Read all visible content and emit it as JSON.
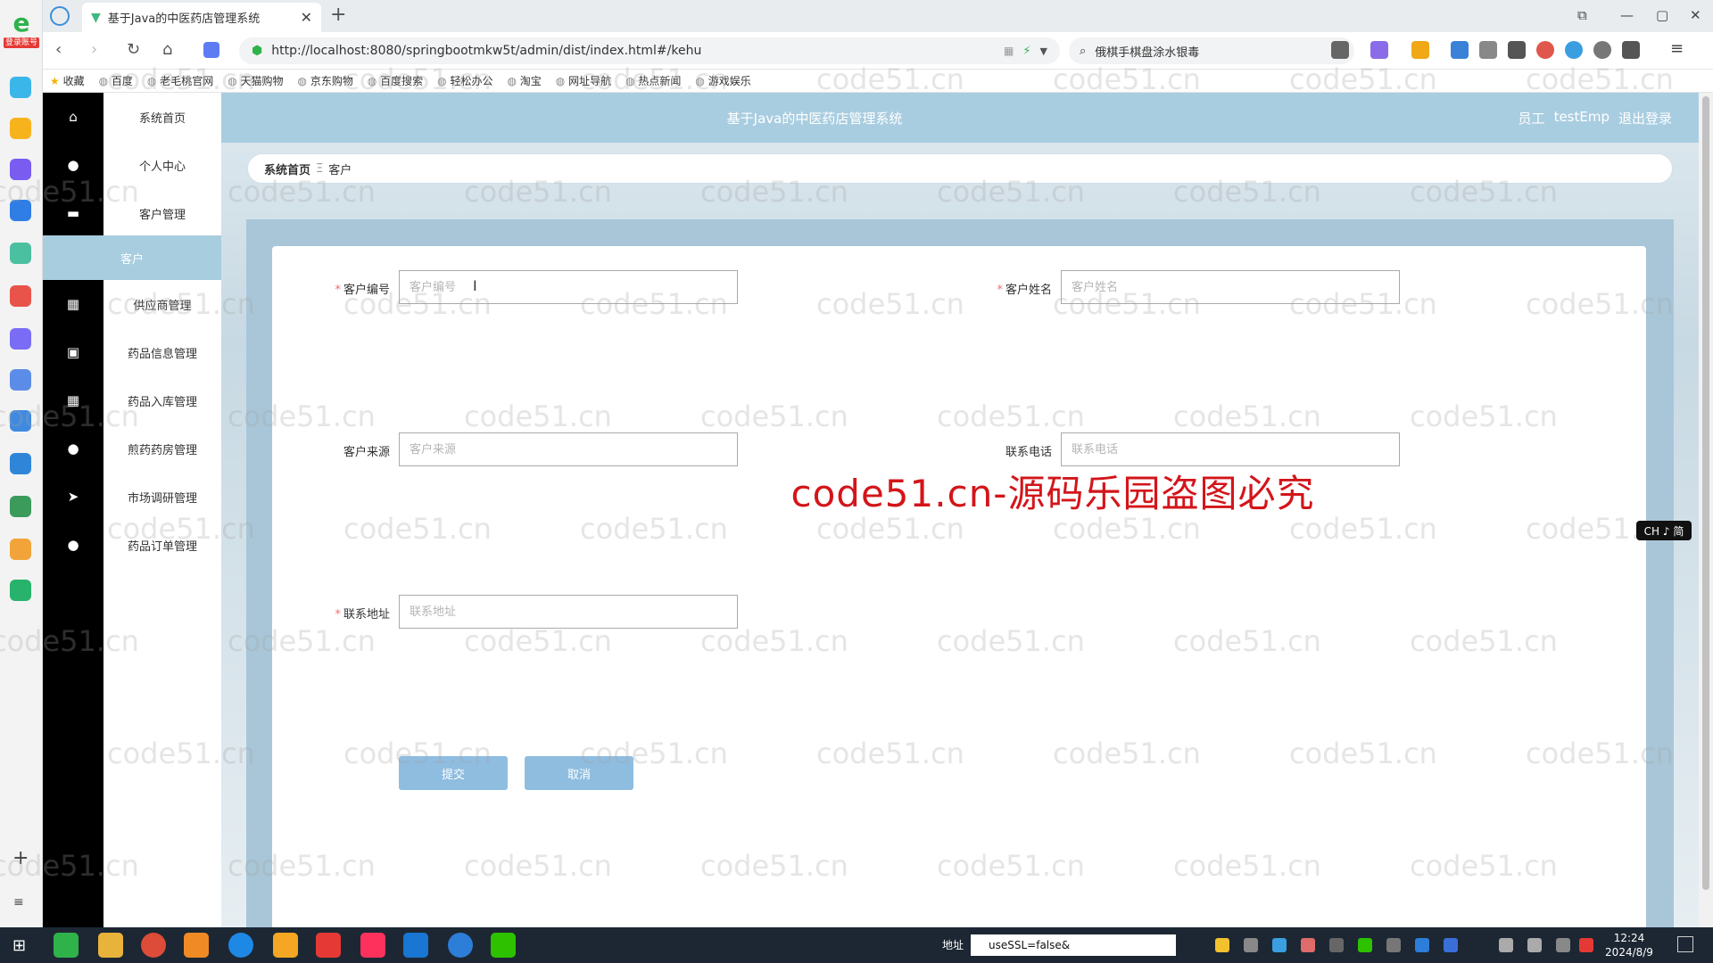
{
  "browser": {
    "tab_title": "基于Java的中医药店管理系统",
    "url": "http://localhost:8080/springbootmkw5t/admin/dist/index.html#/kehu",
    "search_text": "俄棋手棋盘涂水银毒",
    "new_tab": "+",
    "bookmarks": [
      "收藏",
      "百度",
      "老毛桃官网",
      "天猫购物",
      "京东购物",
      "百度搜索",
      "轻松办公",
      "淘宝",
      "网址导航",
      "热点新闻",
      "游戏娱乐"
    ]
  },
  "rail": {
    "badge": "登录账号"
  },
  "app": {
    "title": "基于Java的中医药店管理系统",
    "user_role": "员工",
    "username": "testEmp",
    "logout": "退出登录"
  },
  "menu": {
    "items": [
      "系统首页",
      "个人中心",
      "客户管理",
      "供应商管理",
      "药品信息管理",
      "药品入库管理",
      "煎药药房管理",
      "市场调研管理",
      "药品订单管理"
    ],
    "active_sub": "客户"
  },
  "breadcrumb": {
    "home": "系统首页",
    "sep": "Ξ",
    "current": "客户"
  },
  "form": {
    "customer_no": {
      "label": "客户编号",
      "placeholder": "客户编号",
      "required": true
    },
    "customer_name": {
      "label": "客户姓名",
      "placeholder": "客户姓名",
      "required": true
    },
    "customer_source": {
      "label": "客户来源",
      "placeholder": "客户来源",
      "required": false
    },
    "phone": {
      "label": "联系电话",
      "placeholder": "联系电话",
      "required": false
    },
    "address": {
      "label": "联系地址",
      "placeholder": "联系地址",
      "required": true
    },
    "submit": "提交",
    "cancel": "取消",
    "required_mark": "*"
  },
  "watermark": {
    "main": "code51.cn-源码乐园盗图必究",
    "tile": "code51.cn"
  },
  "ime": "CH ♪ 简",
  "taskbar": {
    "addr_label": "地址",
    "addr_value": "useSSL=false&",
    "time": "12:24",
    "date": "2024/8/9"
  },
  "colors": {
    "sidebar_icon_bg": "#000000",
    "header_bg": "#a9cde0",
    "active_menu_bg": "#a8cddf",
    "button_bg": "#8fbde0",
    "required": "#f56c6c",
    "watermark_red": "#d3151a"
  }
}
